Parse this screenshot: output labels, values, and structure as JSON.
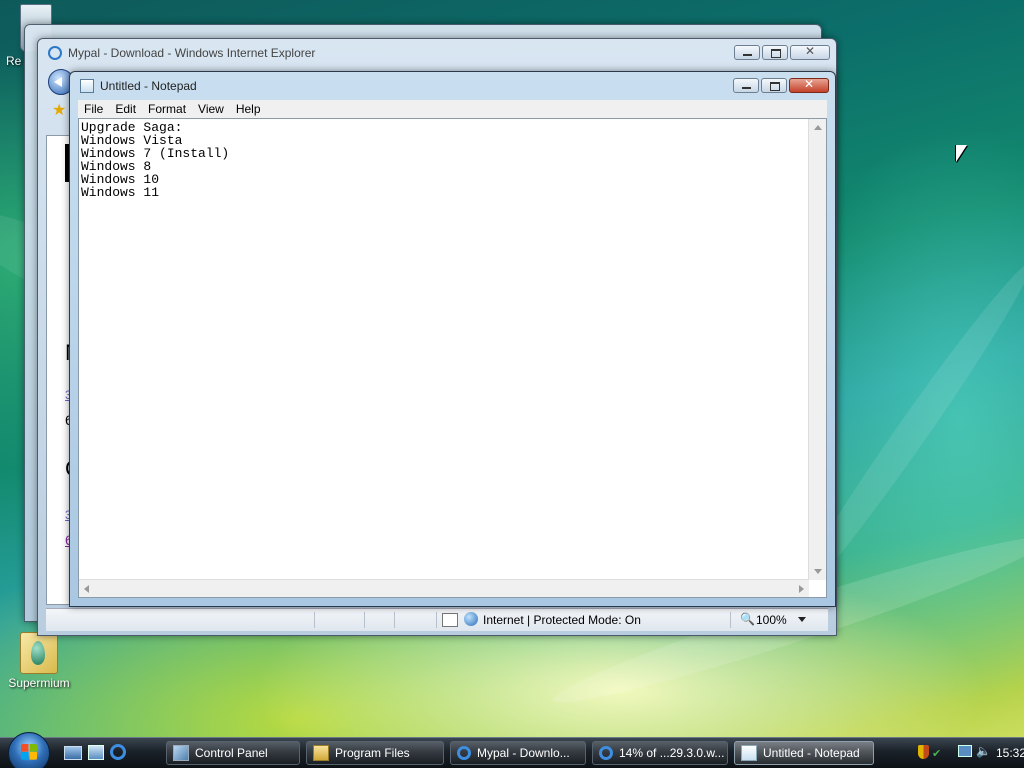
{
  "desktop": {
    "icons": [
      {
        "label": "Re",
        "icon": "recycle-bin-icon"
      },
      {
        "label": "Supermium",
        "icon": "folder-icon"
      }
    ]
  },
  "ie_window": {
    "title": "Mypal - Download - Windows Internet Explorer",
    "page_fragments": [
      "N",
      "3",
      "6",
      "C",
      "3",
      "6"
    ],
    "status": {
      "zone_text": "Internet | Protected Mode: On",
      "zoom": "100%"
    }
  },
  "notepad": {
    "title": "Untitled - Notepad",
    "menu": [
      "File",
      "Edit",
      "Format",
      "View",
      "Help"
    ],
    "content": "Upgrade Saga:\nWindows Vista\nWindows 7 (Install)\nWindows 8\nWindows 10\nWindows 11"
  },
  "taskbar": {
    "quick_launch": [
      "show-desktop-icon",
      "switch-windows-icon",
      "internet-explorer-icon"
    ],
    "buttons": [
      {
        "label": "Control Panel",
        "icon": "control-panel-icon",
        "active": false
      },
      {
        "label": "Program Files",
        "icon": "folder-icon",
        "active": false
      },
      {
        "label": "Mypal - Downlo...",
        "icon": "internet-explorer-icon",
        "active": false
      },
      {
        "label": "14% of ...29.3.0.w...",
        "icon": "internet-explorer-icon",
        "active": false
      },
      {
        "label": "Untitled - Notepad",
        "icon": "notepad-icon",
        "active": true
      }
    ],
    "clock": "15:32"
  }
}
